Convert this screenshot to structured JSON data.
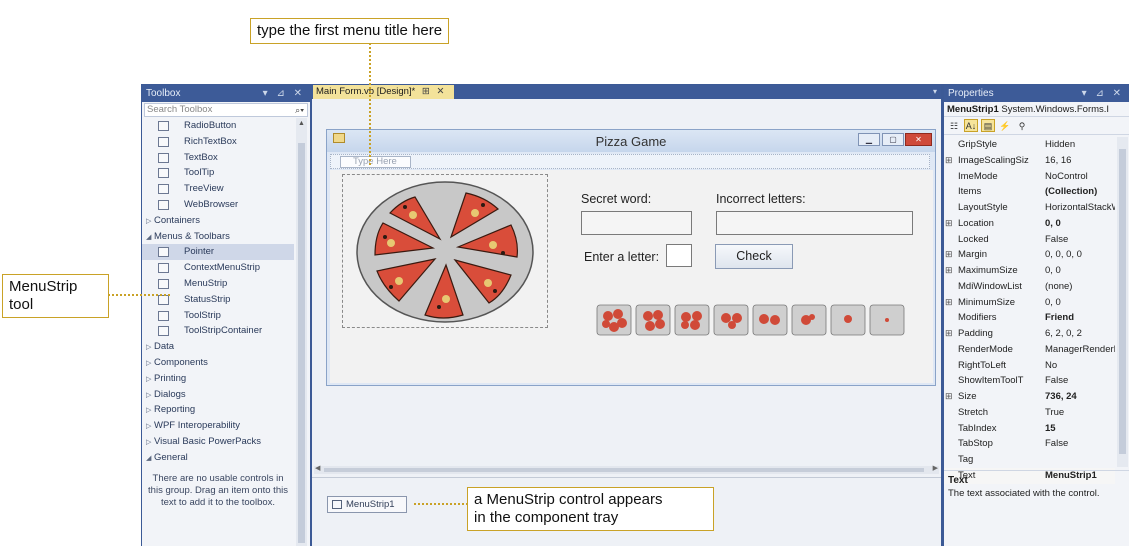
{
  "callouts": {
    "top": "type the first menu title here",
    "left_line1": "MenuStrip",
    "left_line2": "tool",
    "bottom_line1": "a MenuStrip control appears",
    "bottom_line2": "in the component tray"
  },
  "toolbox": {
    "title": "Toolbox",
    "search_placeholder": "Search Toolbox",
    "items": [
      {
        "label": "RadioButton",
        "kind": "tool",
        "icon": "radio-button-icon"
      },
      {
        "label": "RichTextBox",
        "kind": "tool",
        "icon": "rich-textbox-icon"
      },
      {
        "label": "TextBox",
        "kind": "tool",
        "icon": "textbox-icon"
      },
      {
        "label": "ToolTip",
        "kind": "tool",
        "icon": "tooltip-icon"
      },
      {
        "label": "TreeView",
        "kind": "tool",
        "icon": "treeview-icon"
      },
      {
        "label": "WebBrowser",
        "kind": "tool",
        "icon": "webbrowser-icon"
      },
      {
        "label": "Containers",
        "kind": "group",
        "expanded": false
      },
      {
        "label": "Menus & Toolbars",
        "kind": "group",
        "expanded": true
      },
      {
        "label": "Pointer",
        "kind": "tool",
        "icon": "pointer-icon",
        "selected": true
      },
      {
        "label": "ContextMenuStrip",
        "kind": "tool",
        "icon": "context-menu-icon"
      },
      {
        "label": "MenuStrip",
        "kind": "tool",
        "icon": "menustrip-icon"
      },
      {
        "label": "StatusStrip",
        "kind": "tool",
        "icon": "statusstrip-icon"
      },
      {
        "label": "ToolStrip",
        "kind": "tool",
        "icon": "toolstrip-icon"
      },
      {
        "label": "ToolStripContainer",
        "kind": "tool",
        "icon": "toolstrip-container-icon"
      },
      {
        "label": "Data",
        "kind": "group",
        "expanded": false
      },
      {
        "label": "Components",
        "kind": "group",
        "expanded": false
      },
      {
        "label": "Printing",
        "kind": "group",
        "expanded": false
      },
      {
        "label": "Dialogs",
        "kind": "group",
        "expanded": false
      },
      {
        "label": "Reporting",
        "kind": "group",
        "expanded": false
      },
      {
        "label": "WPF Interoperability",
        "kind": "group",
        "expanded": false
      },
      {
        "label": "Visual Basic PowerPacks",
        "kind": "group",
        "expanded": false
      },
      {
        "label": "General",
        "kind": "group",
        "expanded": true
      }
    ],
    "empty_message": "There are no usable controls in this group. Drag an item onto this text to add it to the toolbox."
  },
  "designer": {
    "tab_label": "Main Form.vb [Design]*",
    "form": {
      "title": "Pizza Game",
      "menu_placeholder": "Type Here",
      "secret_label": "Secret word:",
      "incorrect_label": "Incorrect letters:",
      "enter_label": "Enter a letter:",
      "check_label": "Check"
    },
    "tray_item": "MenuStrip1"
  },
  "properties": {
    "title": "Properties",
    "object_name": "MenuStrip1",
    "object_type": "System.Windows.Forms.I",
    "rows": [
      {
        "name": "GripStyle",
        "value": "Hidden",
        "bold": false,
        "expand": false
      },
      {
        "name": "ImageScalingSiz",
        "value": "16, 16",
        "bold": false,
        "expand": true
      },
      {
        "name": "ImeMode",
        "value": "NoControl",
        "bold": false,
        "expand": false
      },
      {
        "name": "Items",
        "value": "(Collection)",
        "bold": true,
        "expand": false
      },
      {
        "name": "LayoutStyle",
        "value": "HorizontalStackWit",
        "bold": false,
        "expand": false
      },
      {
        "name": "Location",
        "value": "0, 0",
        "bold": true,
        "expand": true
      },
      {
        "name": "Locked",
        "value": "False",
        "bold": false,
        "expand": false
      },
      {
        "name": "Margin",
        "value": "0, 0, 0, 0",
        "bold": false,
        "expand": true
      },
      {
        "name": "MaximumSize",
        "value": "0, 0",
        "bold": false,
        "expand": true
      },
      {
        "name": "MdiWindowList",
        "value": "(none)",
        "bold": false,
        "expand": false
      },
      {
        "name": "MinimumSize",
        "value": "0, 0",
        "bold": false,
        "expand": true
      },
      {
        "name": "Modifiers",
        "value": "Friend",
        "bold": true,
        "expand": false
      },
      {
        "name": "Padding",
        "value": "6, 2, 0, 2",
        "bold": false,
        "expand": true
      },
      {
        "name": "RenderMode",
        "value": "ManagerRenderMc",
        "bold": false,
        "expand": false
      },
      {
        "name": "RightToLeft",
        "value": "No",
        "bold": false,
        "expand": false
      },
      {
        "name": "ShowItemToolT",
        "value": "False",
        "bold": false,
        "expand": false
      },
      {
        "name": "Size",
        "value": "736, 24",
        "bold": true,
        "expand": true
      },
      {
        "name": "Stretch",
        "value": "True",
        "bold": false,
        "expand": false
      },
      {
        "name": "TabIndex",
        "value": "15",
        "bold": true,
        "expand": false
      },
      {
        "name": "TabStop",
        "value": "False",
        "bold": false,
        "expand": false
      },
      {
        "name": "Tag",
        "value": "",
        "bold": false,
        "expand": false
      },
      {
        "name": "Text",
        "value": "MenuStrip1",
        "bold": true,
        "expand": false
      }
    ],
    "desc_title": "Text",
    "desc_text": "The text associated with the control."
  },
  "colors": {
    "ide_frame": "#3c5a96",
    "callout_border": "#c9a227",
    "active_tab": "#f3e29a"
  }
}
